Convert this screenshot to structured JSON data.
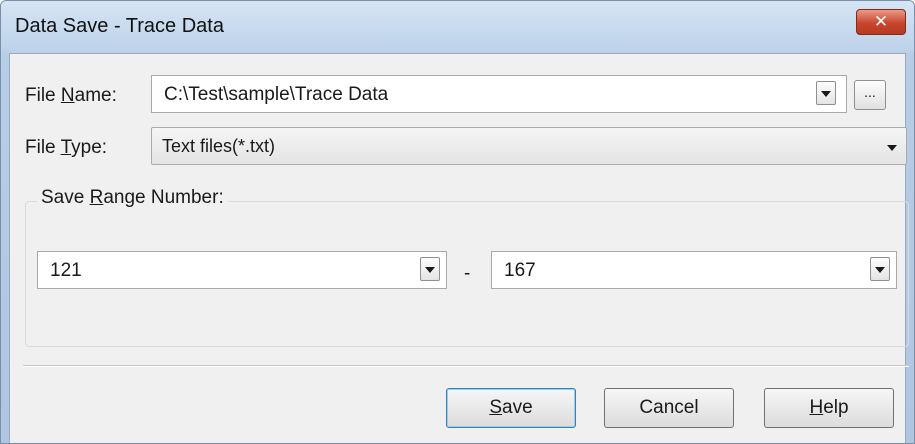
{
  "window": {
    "title": "Data Save - Trace Data",
    "close_glyph": "✕"
  },
  "file_name": {
    "label_prefix": "File ",
    "label_mnemonic": "N",
    "label_suffix": "ame:",
    "value": "C:\\Test\\sample\\Trace Data",
    "browse_label": "..."
  },
  "file_type": {
    "label_prefix": "File ",
    "label_mnemonic": "T",
    "label_suffix": "ype:",
    "value": "Text files(*.txt)"
  },
  "save_range": {
    "label_prefix": "Save ",
    "label_mnemonic": "R",
    "label_suffix": "ange Number:",
    "start": "121",
    "separator": "-",
    "end": "167"
  },
  "buttons": {
    "save_mnemonic": "S",
    "save_suffix": "ave",
    "cancel": "Cancel",
    "help_mnemonic": "H",
    "help_suffix": "elp"
  },
  "icons": {
    "close": "close-icon",
    "dropdown": "chevron-down-icon"
  }
}
